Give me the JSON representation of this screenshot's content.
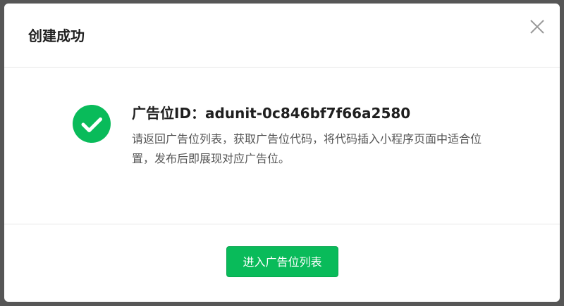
{
  "dialog": {
    "title": "创建成功",
    "close_icon": "close-icon",
    "success_icon": "check-circle-icon",
    "message_title": "广告位ID：adunit-0c846bf7f66a2580",
    "message_desc": "请返回广告位列表，获取广告位代码，将代码插入小程序页面中适合位置，发布后即展现对应广告位。",
    "primary_button": "进入广告位列表"
  },
  "colors": {
    "accent": "#09bb5a",
    "overlay": "#565656",
    "close_icon": "#999999"
  }
}
